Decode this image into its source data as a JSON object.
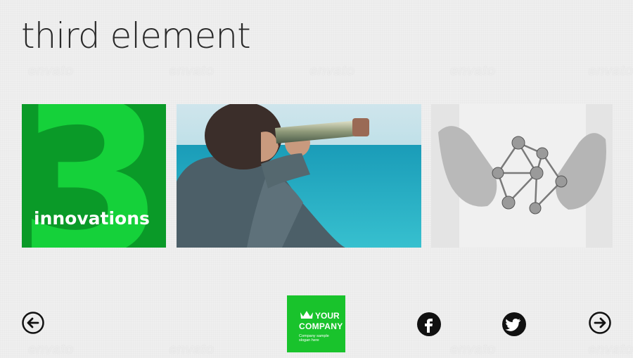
{
  "page": {
    "title": "third element"
  },
  "watermark": {
    "text": "envato"
  },
  "tiles": [
    {
      "type": "number-tile",
      "number": "3",
      "caption": "innovations",
      "background": "#0a9a28",
      "accent": "#15d13a"
    },
    {
      "type": "photo",
      "description_icon": "businessman-telescope-photo"
    },
    {
      "type": "photo",
      "description_icon": "hands-molecule-photo"
    }
  ],
  "footer": {
    "logo": {
      "line1": "YOUR",
      "line2": "COMPANY",
      "line3": "Company sample slogan here",
      "color": "#19c32c"
    },
    "prev_icon": "arrow-left-circle-icon",
    "next_icon": "arrow-right-circle-icon",
    "social": [
      {
        "name": "facebook",
        "icon": "facebook-icon",
        "glyph": "f"
      },
      {
        "name": "twitter",
        "icon": "twitter-icon"
      }
    ]
  }
}
